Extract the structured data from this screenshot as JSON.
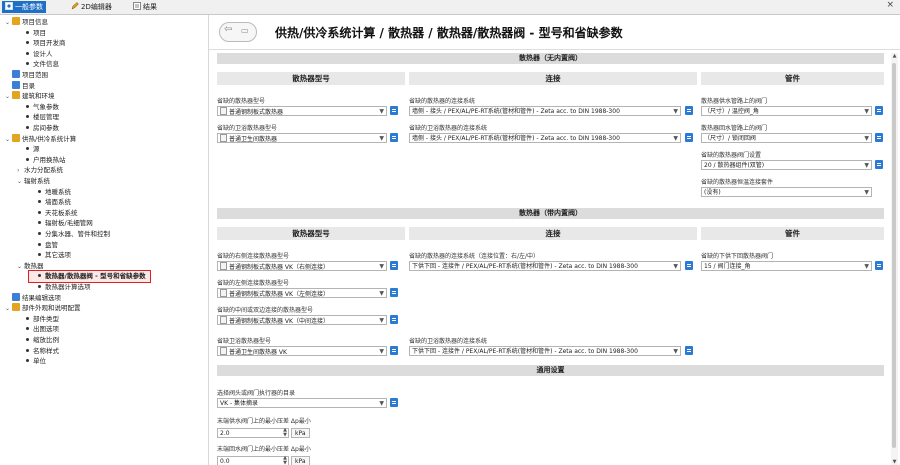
{
  "tabs": [
    {
      "label": "一般参数",
      "active": true
    },
    {
      "label": "2D编辑器",
      "active": false
    },
    {
      "label": "结果",
      "active": false
    }
  ],
  "tree": [
    {
      "label": "项目信息",
      "kind": "folder"
    },
    {
      "label": "项目",
      "kind": "leaf"
    },
    {
      "label": "项目开发商",
      "kind": "leaf"
    },
    {
      "label": "设计人",
      "kind": "leaf"
    },
    {
      "label": "文件信息",
      "kind": "leaf"
    },
    {
      "label": "项目范围",
      "kind": "doc"
    },
    {
      "label": "目录",
      "kind": "doc"
    },
    {
      "label": "建筑和环境",
      "kind": "folder"
    },
    {
      "label": "气象参数",
      "kind": "leaf"
    },
    {
      "label": "楼层管理",
      "kind": "leaf"
    },
    {
      "label": "房间参数",
      "kind": "leaf"
    },
    {
      "label": "供热/供冷系统计算",
      "kind": "folder"
    },
    {
      "label": "源",
      "kind": "leaf"
    },
    {
      "label": "户用换热站",
      "kind": "leaf"
    },
    {
      "label": "水力分配系统",
      "kind": "collapsed"
    },
    {
      "label": "辐射系统",
      "kind": "open"
    },
    {
      "label": "地暖系统",
      "kind": "leaf"
    },
    {
      "label": "墙面系统",
      "kind": "leaf"
    },
    {
      "label": "天花板系统",
      "kind": "leaf"
    },
    {
      "label": "辐射板/毛细管网",
      "kind": "leaf"
    },
    {
      "label": "分集水器、管件和控制",
      "kind": "leaf"
    },
    {
      "label": "盘管",
      "kind": "leaf"
    },
    {
      "label": "其它选项",
      "kind": "leaf"
    },
    {
      "label": "散热器",
      "kind": "open"
    },
    {
      "label": "散热器/散热器阀 - 型号和省缺参数",
      "kind": "leaf",
      "selected": true
    },
    {
      "label": "散热器计算选项",
      "kind": "leaf"
    },
    {
      "label": "结果编辑选项",
      "kind": "doc"
    },
    {
      "label": "部件外观和说明配置",
      "kind": "folder"
    },
    {
      "label": "部件类型",
      "kind": "leaf"
    },
    {
      "label": "出图选项",
      "kind": "leaf"
    },
    {
      "label": "缩放比例",
      "kind": "leaf"
    },
    {
      "label": "名称样式",
      "kind": "leaf"
    },
    {
      "label": "单位",
      "kind": "leaf"
    }
  ],
  "page_title": "供热/供冷系统计算 / 散热器 / 散热器/散热器阀 - 型号和省缺参数",
  "sec1": {
    "band": "散热器（无内置阀）",
    "col1": "散热器型号",
    "col2": "连接",
    "col3": "管件",
    "f1_label": "省缺的散热器型号",
    "f1_value": "普通钢制板式散热器",
    "f2_label": "省缺的卫浴散热器型号",
    "f2_value": "普通卫生间散热器",
    "c1_label": "省缺的散热器的连接系统",
    "c1_value": "墙侧 - 接头 / PEX/AL/PE-RT系统(管材和管件) - Zeta acc. to DIN 1988-300",
    "c2_label": "省缺的卫浴散热器的连接系统",
    "c2_value": "墙侧 - 接头 / PEX/AL/PE-RT系统(管材和管件) - Zeta acc. to DIN 1988-300",
    "p1_label": "散热器供水管路上的阀门",
    "p1_value": "（尺寸）/ 温控阀_角",
    "p2_label": "散热器回水管路上的阀门",
    "p2_value": "（尺寸）/ 锁闭回阀",
    "p3_label": "省缺的散热器阀门设置",
    "p3_value": "20 / 散热器组件(双管)",
    "p4_label": "省缺的散热器恒温连接套件",
    "p4_value": "(没有)"
  },
  "sec2": {
    "band": "散热器（带内置阀）",
    "col1": "散热器型号",
    "col2": "连接",
    "col3": "管件",
    "f1_label": "省缺的右侧连接散热器型号",
    "f1_value": "普通钢制板式散热器 VK（右侧连接）",
    "f2_label": "省缺的左侧连接散热器型号",
    "f2_value": "普通钢制板式散热器 VK（左侧连接）",
    "f3_label": "省缺的中间或双边连接的散热器型号",
    "f3_value": "普通钢制板式散热器 VK（中间连接）",
    "f4_label": "省缺卫浴散热器型号",
    "f4_value": "普通卫生间散热器 VK",
    "c1_label": "省缺的散热器的连接系统（连接位置：右/左/中）",
    "c1_value": "下供下回 - 连接件 / PEX/AL/PE-RT系统(管材和管件) - Zeta acc. to DIN 1988-300",
    "c2_label": "省缺的卫浴散热器的连接系统",
    "c2_value": "下供下回 - 连接件 / PEX/AL/PE-RT系统(管材和管件) - Zeta acc. to DIN 1988-300",
    "p1_label": "省缺的下供下回散热器阀门",
    "p1_value": "15 / 阀门连接_角"
  },
  "sec3": {
    "band": "通用设置",
    "s1_label": "选择阀头或阀门执行器的目录",
    "s1_value": "VK - 集体摘录",
    "s2_label": "末端供水阀门上的最小压差 Δp最小",
    "s2_value": "2.0",
    "s2_unit": "kPa",
    "s3_label": "末端回水阀门上的最小压差 Δp最小",
    "s3_value": "0.0",
    "s3_unit": "kPa"
  }
}
